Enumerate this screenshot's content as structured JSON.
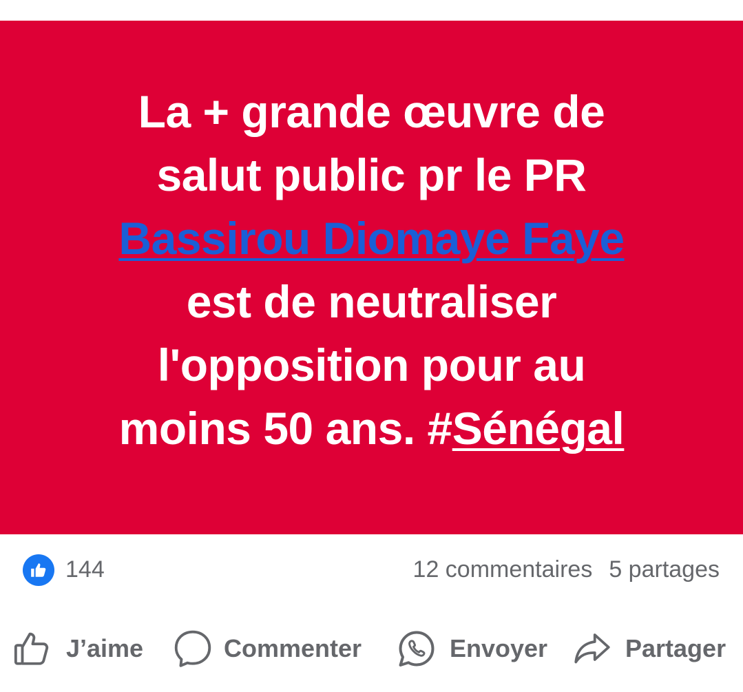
{
  "post": {
    "background_color": "#de0036",
    "text_color": "#ffffff",
    "mention_color": "#1a5fd6",
    "lines": {
      "line1": "La + grande œuvre de",
      "line2": "salut public pr le PR",
      "mention": "Bassirou Diomaye Faye",
      "line4": "est de neutraliser",
      "line5": "l'opposition pour au",
      "line6_prefix": "moins 50 ans. #",
      "hashtag": "Sénégal"
    }
  },
  "stats": {
    "like_icon": "thumbs-up-icon",
    "like_color": "#1877f2",
    "like_count": "144",
    "comments": "12 commentaires",
    "shares": "5 partages"
  },
  "actions": {
    "like": {
      "label": "J’aime",
      "icon": "thumbs-up-outline-icon"
    },
    "comment": {
      "label": "Commenter",
      "icon": "speech-bubble-icon"
    },
    "send": {
      "label": "Envoyer",
      "icon": "whatsapp-icon"
    },
    "share": {
      "label": "Partager",
      "icon": "share-arrow-icon"
    }
  }
}
